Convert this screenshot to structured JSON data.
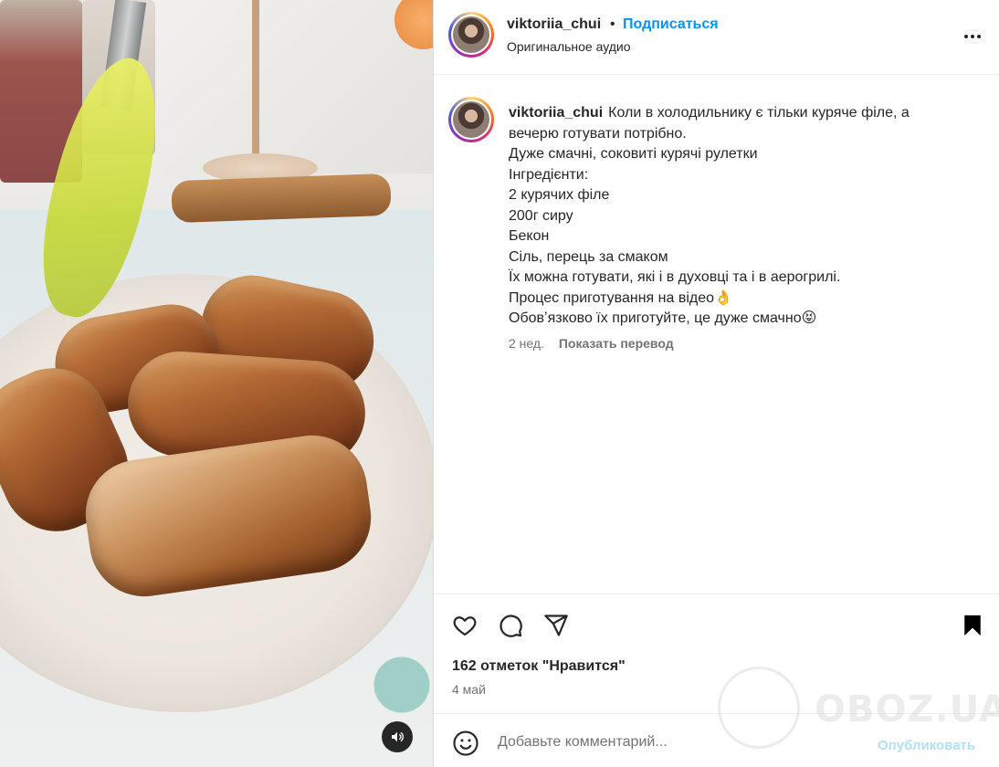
{
  "media": {
    "sound_icon": "speaker-icon",
    "alt_description": ""
  },
  "post": {
    "username": "viktoriia_chui",
    "separator": "•",
    "follow_label": "Подписаться",
    "audio_label": "Оригинальное аудио",
    "more_icon": "more-horizontal-icon"
  },
  "caption": {
    "username": "viktoriia_chui",
    "lines": [
      "Коли в холодильнику є тільки куряче філе, а",
      "вечерю готувати потрібно.",
      "Дуже смачні, соковиті курячі рулетки",
      "Інгредієнти:",
      "2 курячих філе",
      "200г сиру",
      "Бекон",
      "Сіль, перець за смаком",
      "Їх можна готувати, які і в духовці та і в аерогрилі.",
      "Процес приготування на відео👌",
      "Обовʼязково їх приготуйте, це дуже смачно😝"
    ],
    "age": "2 нед.",
    "translate_label": "Показать перевод"
  },
  "actions": {
    "likes_text": "162 отметок \"Нравится\"",
    "date": "4 май",
    "icons": [
      "heart-icon",
      "comment-icon",
      "share-icon",
      "bookmark-icon"
    ]
  },
  "comment": {
    "placeholder": "Добавьте комментарий...",
    "publish_label": "Опубликовать",
    "emoji_icon": "emoji-icon"
  },
  "watermark": {
    "text": "OBOZ.UA"
  },
  "colors": {
    "accent": "#0095f6",
    "text": "#262626",
    "secondary": "#737373",
    "publish_disabled": "#b2dffc"
  }
}
